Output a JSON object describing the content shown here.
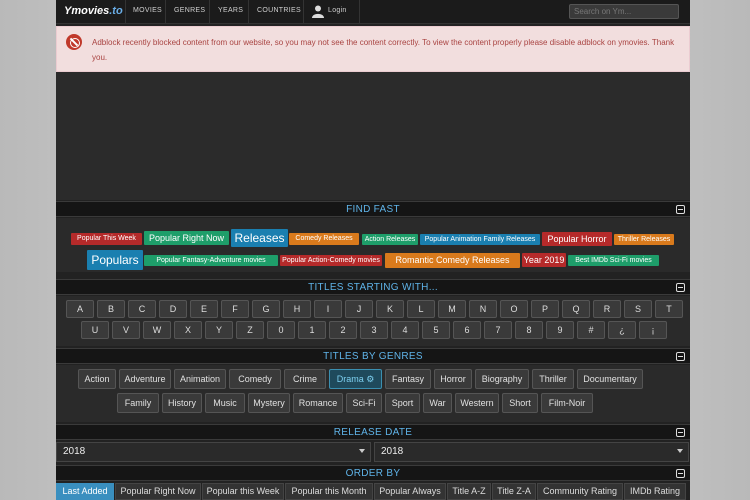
{
  "nav": {
    "logo": "Ymovies",
    "logo_tld": ".to",
    "items": [
      "MOVIES",
      "GENRES",
      "YEARS",
      "COUNTRIES"
    ],
    "login": "Login",
    "search_placeholder": "Search on Ym..."
  },
  "adblock": {
    "message": "Adblock recently blocked content from our website, so you may not see the content correctly. To view the content properly please disable adblock on ymovies. Thank you."
  },
  "find_fast": {
    "title": "FIND FAST",
    "tags": [
      {
        "label": "Popular This Week",
        "color": "#b52a2a"
      },
      {
        "label": "Popular Right Now",
        "color": "#1e9e6a"
      },
      {
        "label": "Releases",
        "color": "#1a7fb0"
      },
      {
        "label": "Comedy Releases",
        "color": "#d97a1c"
      },
      {
        "label": "Action Releases",
        "color": "#1e9e6a"
      },
      {
        "label": "Popular Animation Family Releases",
        "color": "#1a7fb0"
      },
      {
        "label": "Popular Horror",
        "color": "#b52a2a"
      },
      {
        "label": "Thriller Releases",
        "color": "#d97a1c"
      },
      {
        "label": "Populars",
        "color": "#1a7fb0"
      },
      {
        "label": "Popular Fantasy-Adventure movies",
        "color": "#1e9e6a"
      },
      {
        "label": "Popular Action-Comedy movies",
        "color": "#b52a2a"
      },
      {
        "label": "Romantic Comedy Releases",
        "color": "#d97a1c"
      },
      {
        "label": "Year 2019",
        "color": "#b52a2a"
      },
      {
        "label": "Best IMDb Sci-Fi movies",
        "color": "#1e9e6a"
      }
    ]
  },
  "titles_starting": {
    "title": "TITLES STARTING WITH...",
    "row1": [
      "A",
      "B",
      "C",
      "D",
      "E",
      "F",
      "G",
      "H",
      "I",
      "J",
      "K",
      "L",
      "M",
      "N",
      "O",
      "P",
      "Q",
      "R",
      "S",
      "T"
    ],
    "row2": [
      "U",
      "V",
      "W",
      "X",
      "Y",
      "Z",
      "0",
      "1",
      "2",
      "3",
      "4",
      "5",
      "6",
      "7",
      "8",
      "9",
      "#",
      "¿",
      "¡"
    ]
  },
  "genres": {
    "title": "TITLES BY GENRES",
    "row1": [
      "Action",
      "Adventure",
      "Animation",
      "Comedy",
      "Crime",
      "Drama",
      "Fantasy",
      "Horror",
      "Biography",
      "Thriller",
      "Documentary"
    ],
    "row2": [
      "Family",
      "History",
      "Music",
      "Mystery",
      "Romance",
      "Sci-Fi",
      "Sport",
      "War",
      "Western",
      "Short",
      "Film-Noir"
    ],
    "active": "Drama"
  },
  "release_date": {
    "title": "RELEASE DATE",
    "from": "2018",
    "to": "2018"
  },
  "order_by": {
    "title": "ORDER BY",
    "options": [
      "Last Added",
      "Popular Right Now",
      "Popular this Week",
      "Popular this Month",
      "Popular Always",
      "Title A-Z",
      "Title Z-A",
      "Community Rating",
      "IMDb Rating"
    ],
    "active": "Last Added"
  }
}
